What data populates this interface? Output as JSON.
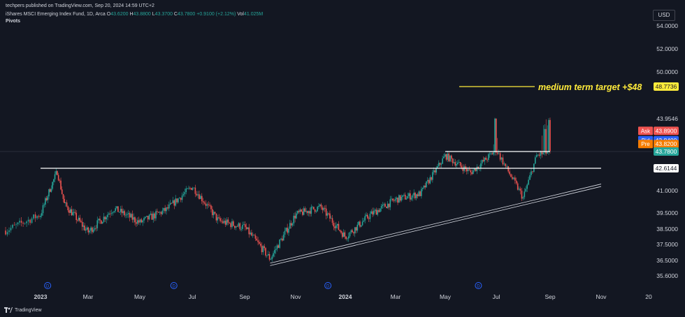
{
  "header": {
    "publisher": "techpers published on TradingView.com, Sep 20, 2024 14:59 UTC+2",
    "symbol_title": "iShares MSCI Emerging Index Fund, 1D, Arca",
    "ohlc": [
      {
        "label": "O",
        "value": "43.6200"
      },
      {
        "label": "H",
        "value": "43.8800"
      },
      {
        "label": "L",
        "value": "43.3700"
      },
      {
        "label": "C",
        "value": "43.7800"
      },
      {
        "label": "",
        "value": "+0.9100 (+2.12%)"
      },
      {
        "label": "Vol",
        "value": "41.025M"
      }
    ],
    "indicator": "Pivots"
  },
  "currency": "USD",
  "footer_brand": "TradingView",
  "colors": {
    "background": "#131722",
    "up": "#26a69a",
    "down": "#ef5350",
    "text": "#d1d4dc",
    "annotation": "#ffeb3b",
    "ask": "#ef5350",
    "bid": "#2962ff",
    "pre": "#f57c00",
    "last": "#26a69a"
  },
  "chart_data": {
    "type": "candlestick",
    "x_axis_labels": [
      "2023",
      "Mar",
      "May",
      "Jul",
      "Sep",
      "Nov",
      "2024",
      "Mar",
      "May",
      "Jul",
      "Sep",
      "Nov",
      "20"
    ],
    "x_axis_bold": [
      "2023",
      "2024"
    ],
    "dividend_markers": [
      "Jan 2023",
      "Jun 2023",
      "Dec 2023",
      "Jun 2024"
    ],
    "dividend_marker_label": "D",
    "y_axis_ticks": [
      "54.0000",
      "52.0000",
      "50.0000",
      "43.9546",
      "41.0000",
      "39.5000",
      "38.5000",
      "37.5000",
      "36.5000",
      "35.6000"
    ],
    "y_axis_tick_values": [
      54,
      52,
      50,
      43.9546,
      41,
      39.5,
      38.5,
      37.5,
      36.5,
      35.6
    ],
    "y_axis_mapping": {
      "upper_range": [
        50,
        54
      ],
      "lower_range": [
        35.6,
        43.9546
      ],
      "note_scale": "non-uniform as printed"
    },
    "price_labels": [
      {
        "text": "48.7736",
        "value": 48.7736,
        "kind": "target"
      },
      {
        "text": "43.8900",
        "value": 43.89,
        "kind": "ask",
        "tag": "Ask"
      },
      {
        "text": "43.8400",
        "value": 43.84,
        "kind": "bid",
        "tag": "Bid"
      },
      {
        "text": "43.8200",
        "value": 43.82,
        "kind": "pre",
        "tag": "Pre"
      },
      {
        "text": "43.7800",
        "value": 43.78,
        "kind": "last"
      },
      {
        "text": "42.6144",
        "value": 42.6144,
        "kind": "support"
      }
    ],
    "annotation": {
      "text": "medium term target +$48",
      "value": 48.7736
    },
    "horizontal_lines": [
      {
        "value": 43.78,
        "from": "May 2024",
        "to": "Sep 2024"
      },
      {
        "value": 42.6144,
        "from": "Jan 2023",
        "to": "Nov 2024"
      }
    ],
    "trendline": {
      "from": [
        "Oct 2023",
        36.2
      ],
      "to": [
        "Nov 2024",
        41.3
      ]
    },
    "x_range": [
      "Dec 2022",
      "Dec 2024"
    ],
    "y_range": [
      35.6,
      54
    ],
    "approx_close_path": [
      [
        "Dec 2022",
        38.4
      ],
      [
        "Jan 2023",
        39.4
      ],
      [
        "late Jan 2023",
        42.4
      ],
      [
        "Feb 2023",
        40.1
      ],
      [
        "Mar 2023",
        38.3
      ],
      [
        "Apr 2023",
        39.8
      ],
      [
        "May 2023",
        38.9
      ],
      [
        "Jun 2023",
        39.7
      ],
      [
        "Jul 2023",
        41.3
      ],
      [
        "Aug 2023",
        39.0
      ],
      [
        "Sep 2023",
        38.6
      ],
      [
        "Oct 2023",
        36.6
      ],
      [
        "Nov 2023",
        39.4
      ],
      [
        "Dec 2023",
        39.9
      ],
      [
        "Jan 2024",
        38.0
      ],
      [
        "Feb 2024",
        39.4
      ],
      [
        "Mar 2024",
        40.4
      ],
      [
        "Apr 2024",
        40.8
      ],
      [
        "May 2024",
        43.5
      ],
      [
        "Jun 2024",
        42.3
      ],
      [
        "Jul 2024",
        43.9
      ],
      [
        "Aug 2024",
        40.5
      ],
      [
        "Aug 2024",
        43.5
      ],
      [
        "Sep 2024",
        43.78
      ]
    ],
    "grid": false,
    "legend": "none"
  }
}
